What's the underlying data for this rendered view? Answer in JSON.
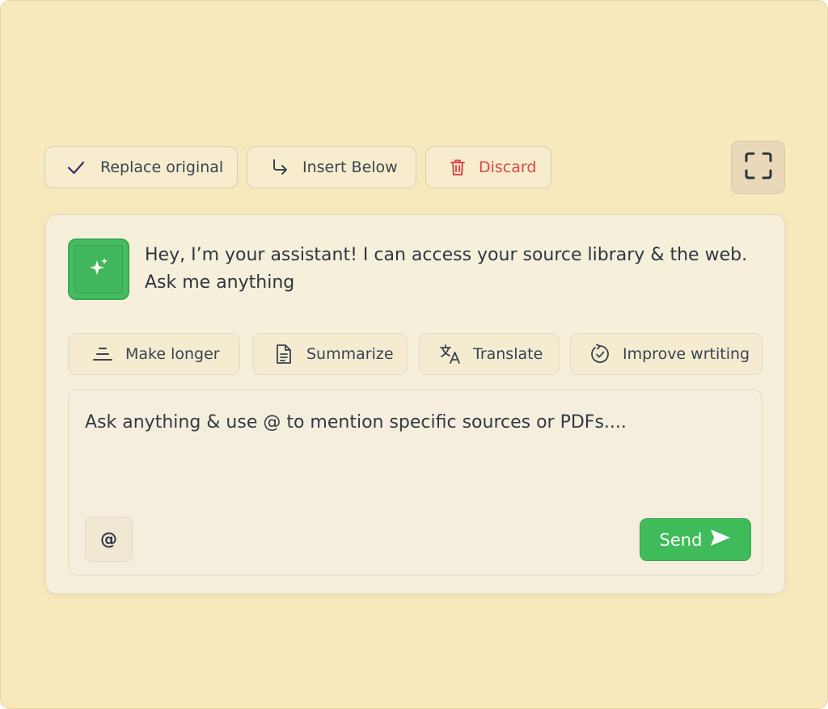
{
  "toolbar": {
    "replace_label": "Replace original",
    "insert_label": "Insert Below",
    "discard_label": "Discard",
    "expand_icon": "expand-icon"
  },
  "assistant": {
    "avatar_icon": "sparkle-icon",
    "greeting_line1": "Hey, I’m your assistant! I can access your source library & the web.",
    "greeting_line2": "Ask me anything"
  },
  "actions": [
    {
      "label": "Make longer",
      "icon": "align-lines-icon"
    },
    {
      "label": "Summarize",
      "icon": "document-icon"
    },
    {
      "label": "Translate",
      "icon": "translate-icon"
    },
    {
      "label": "Improve wrtiting",
      "icon": "refresh-check-icon"
    }
  ],
  "composer": {
    "placeholder": "Ask anything & use @ to mention specific sources or PDFs....",
    "mention_label": "@",
    "send_label": "Send"
  },
  "colors": {
    "background": "#f8e9bd",
    "accent_green": "#3fbb59",
    "danger_red": "#e0474d",
    "text_dark": "#2f3642"
  }
}
